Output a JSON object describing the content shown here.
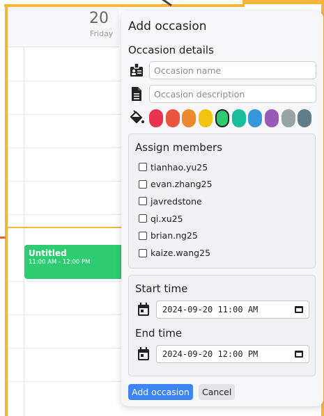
{
  "calendar": {
    "day_number": "20",
    "day_name": "Friday",
    "event": {
      "title": "Untitled",
      "time": "11:00 AM - 12:00 PM",
      "color": "#2ecc71"
    }
  },
  "dialog": {
    "title": "Add occasion",
    "details_label": "Occasion details",
    "name_placeholder": "Occasion name",
    "description_placeholder": "Occasion description",
    "colors": [
      {
        "name": "crimson",
        "hex": "#e8344e",
        "selected": false
      },
      {
        "name": "red-orange",
        "hex": "#e9553e",
        "selected": false
      },
      {
        "name": "orange",
        "hex": "#ea8a2a",
        "selected": false
      },
      {
        "name": "yellow",
        "hex": "#f1c40f",
        "selected": false
      },
      {
        "name": "green",
        "hex": "#2ecc71",
        "selected": true
      },
      {
        "name": "teal",
        "hex": "#1abc9c",
        "selected": false
      },
      {
        "name": "blue",
        "hex": "#3498db",
        "selected": false
      },
      {
        "name": "purple",
        "hex": "#9b59b6",
        "selected": false
      },
      {
        "name": "gray",
        "hex": "#95a5a6",
        "selected": false
      },
      {
        "name": "slate",
        "hex": "#607d8b",
        "selected": false
      }
    ],
    "members_label": "Assign members",
    "members": [
      "tianhao.yu25",
      "evan.zhang25",
      "javredstone",
      "qi.xu25",
      "brian.ng25",
      "kaize.wang25"
    ],
    "start_label": "Start time",
    "start_value": "2024-09-20 11:00 AM",
    "end_label": "End time",
    "end_value": "2024-09-20 12:00 PM",
    "submit_label": "Add occasion",
    "cancel_label": "Cancel",
    "accent": "#3d84f5"
  }
}
